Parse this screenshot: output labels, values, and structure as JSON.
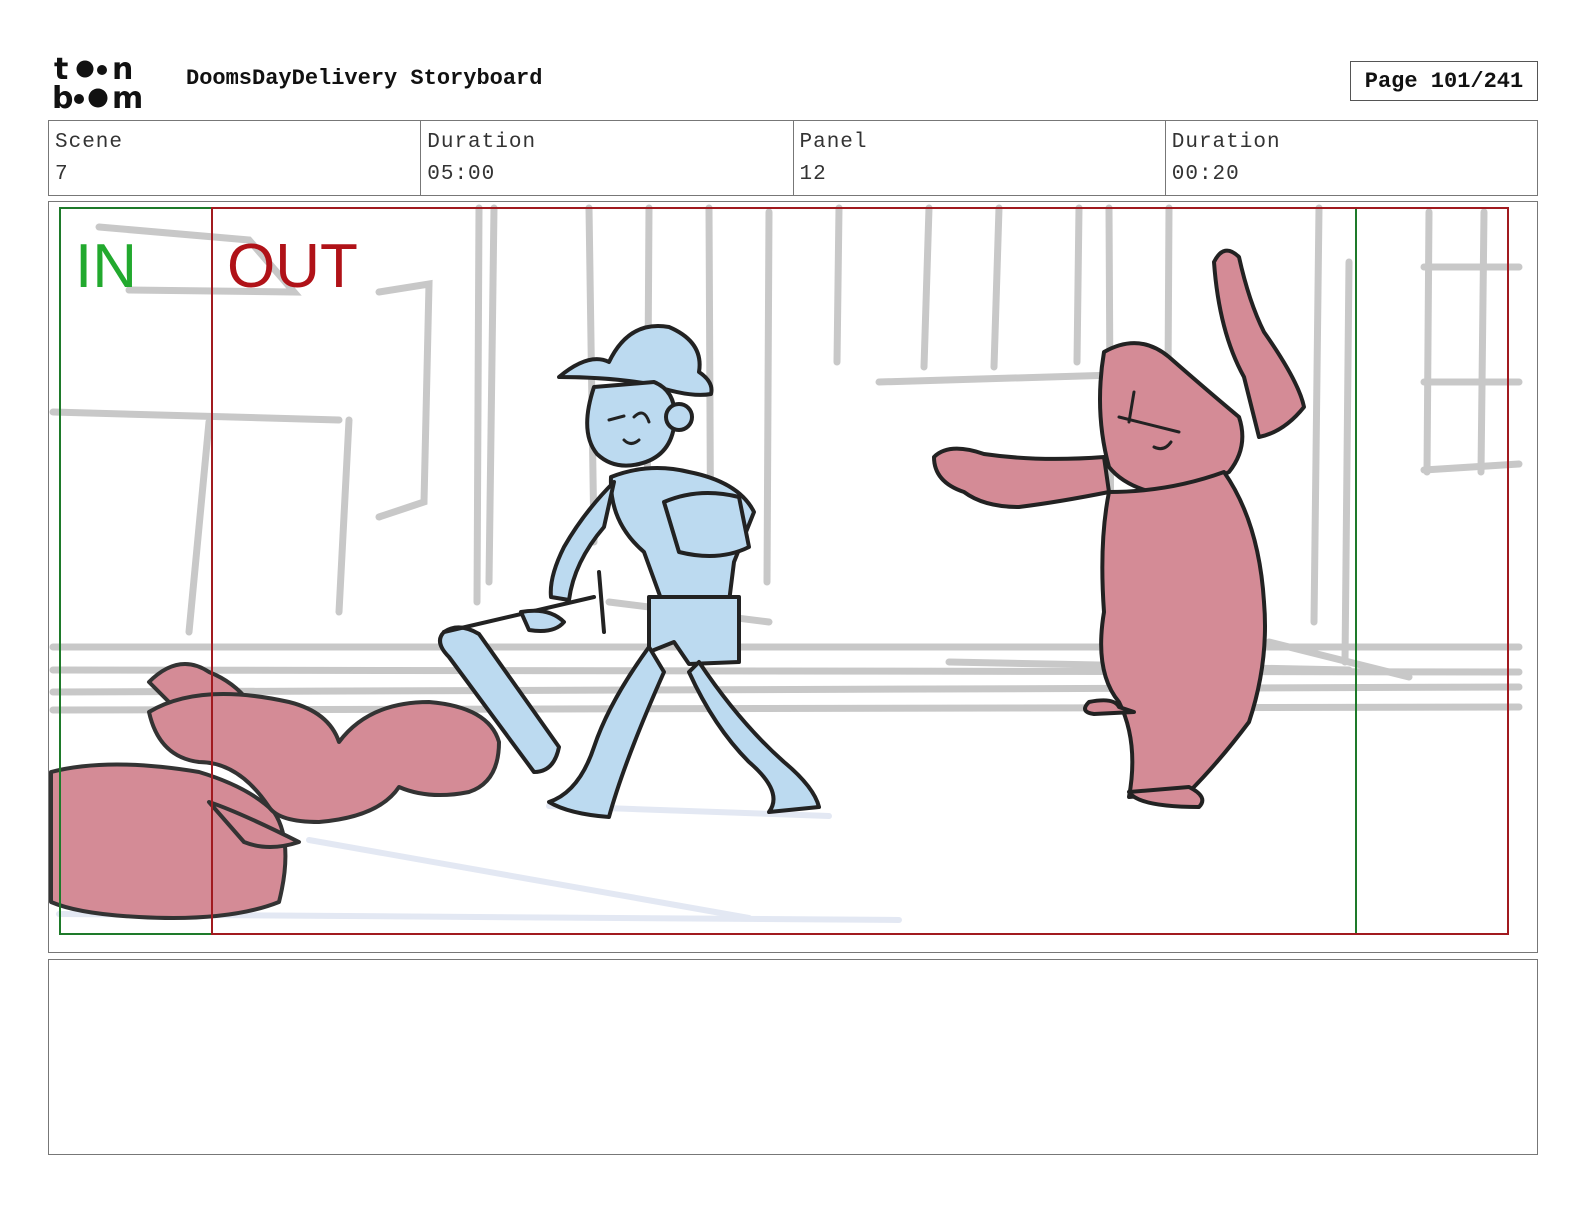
{
  "header": {
    "project_title": "DoomsDayDelivery Storyboard",
    "page_counter": "Page 101/241",
    "logo_text": "toon boom"
  },
  "info": {
    "scene_label": "Scene",
    "scene_value": "7",
    "scene_duration_label": "Duration",
    "scene_duration_value": "05:00",
    "panel_label": "Panel",
    "panel_value": "12",
    "panel_duration_label": "Duration",
    "panel_duration_value": "00:20"
  },
  "panel": {
    "in_label": "IN",
    "out_label": "OUT",
    "colors": {
      "in_frame": "#1e7a2a",
      "in_text": "#22a92e",
      "out_frame": "#a11a1f",
      "out_text": "#b01218",
      "hero_fill": "#bcdaf0",
      "villain_fill": "#d48b96",
      "background_lines": "#c8c8c8"
    }
  },
  "notes": {
    "text": ""
  }
}
